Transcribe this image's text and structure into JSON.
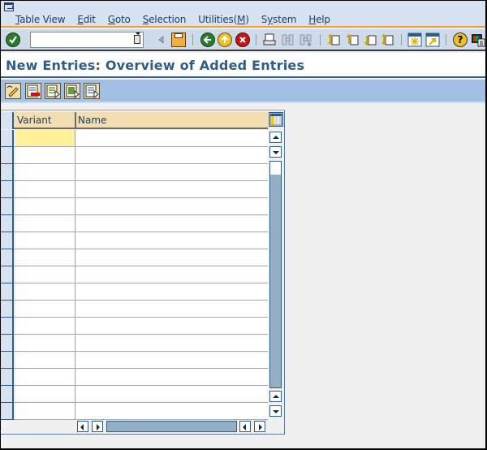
{
  "window": {
    "system_menu_icon": "system-menu-icon"
  },
  "menubar": {
    "items": [
      {
        "label": "Table View",
        "accel": "T"
      },
      {
        "label": "Edit",
        "accel": "E"
      },
      {
        "label": "Goto",
        "accel": "G"
      },
      {
        "label": "Selection",
        "accel": "S"
      },
      {
        "label": "Utilities(M)",
        "accel": "M"
      },
      {
        "label": "System",
        "accel": "y"
      },
      {
        "label": "Help",
        "accel": "H"
      }
    ]
  },
  "toolbar": {
    "command_field": {
      "value": "",
      "placeholder": ""
    },
    "icons": [
      "enter-icon",
      "command-dropdown-icon",
      "collapse-icon",
      "save-icon",
      "back-icon",
      "exit-icon",
      "cancel-icon",
      "print-icon",
      "find-icon",
      "find-next-icon",
      "first-page-icon",
      "previous-page-icon",
      "next-page-icon",
      "last-page-icon",
      "create-session-icon",
      "shortcut-icon",
      "help-icon",
      "layout-menu-icon"
    ]
  },
  "header": {
    "title": "New Entries: Overview of Added Entries"
  },
  "app_toolbar": {
    "buttons": [
      "change-display-icon",
      "delete-icon",
      "previous-entry-icon",
      "next-entry-icon",
      "other-entry-icon"
    ]
  },
  "table": {
    "columns": [
      "Variant",
      "Name"
    ],
    "rows": [
      [
        "",
        ""
      ],
      [
        "",
        ""
      ],
      [
        "",
        ""
      ],
      [
        "",
        ""
      ],
      [
        "",
        ""
      ],
      [
        "",
        ""
      ],
      [
        "",
        ""
      ],
      [
        "",
        ""
      ],
      [
        "",
        ""
      ],
      [
        "",
        ""
      ],
      [
        "",
        ""
      ],
      [
        "",
        ""
      ],
      [
        "",
        ""
      ],
      [
        "",
        ""
      ],
      [
        "",
        ""
      ],
      [
        "",
        ""
      ],
      [
        "",
        ""
      ]
    ],
    "active_cell": {
      "row": 0,
      "column": "Variant"
    }
  },
  "colors": {
    "accent": "#f0a030",
    "title": "#2f5d8a",
    "header_bg": "#f2deb0",
    "active_cell": "#fff09a",
    "app_toolbar": "#a2c0e4"
  }
}
